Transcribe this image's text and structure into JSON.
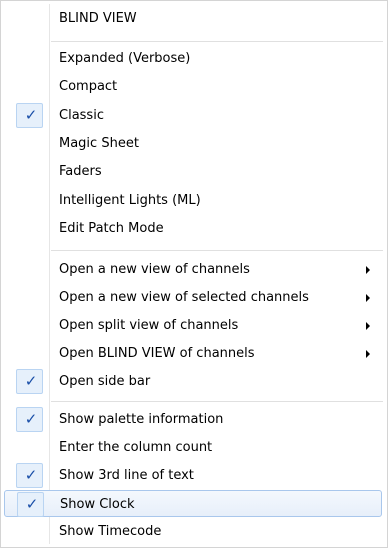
{
  "menu": {
    "header": "BLIND VIEW",
    "view_modes": [
      {
        "label": "Expanded (Verbose)",
        "checked": false
      },
      {
        "label": "Compact",
        "checked": false
      },
      {
        "label": "Classic",
        "checked": true
      },
      {
        "label": "Magic Sheet",
        "checked": false
      },
      {
        "label": "Faders",
        "checked": false
      },
      {
        "label": "Intelligent Lights (ML)",
        "checked": false
      },
      {
        "label": "Edit Patch Mode",
        "checked": false
      }
    ],
    "open_views": [
      {
        "label": "Open a new view of channels",
        "submenu": true
      },
      {
        "label": "Open a new view of selected channels",
        "submenu": true
      },
      {
        "label": "Open split view of channels",
        "submenu": true
      },
      {
        "label": "Open BLIND VIEW of channels",
        "submenu": true
      },
      {
        "label": "Open side bar",
        "checked": true
      }
    ],
    "display_options": [
      {
        "label": "Show palette information",
        "checked": true
      },
      {
        "label": "Enter the column count",
        "checked": false
      },
      {
        "label": "Show 3rd line of text",
        "checked": true
      },
      {
        "label": "Show Clock",
        "checked": true,
        "highlighted": true
      },
      {
        "label": "Show Timecode",
        "checked": false
      }
    ],
    "check_glyph": "✓",
    "colors": {
      "check": "#1a4fa8",
      "hover_border": "#a9c7ec",
      "hover_fill": "#e7effa"
    }
  }
}
